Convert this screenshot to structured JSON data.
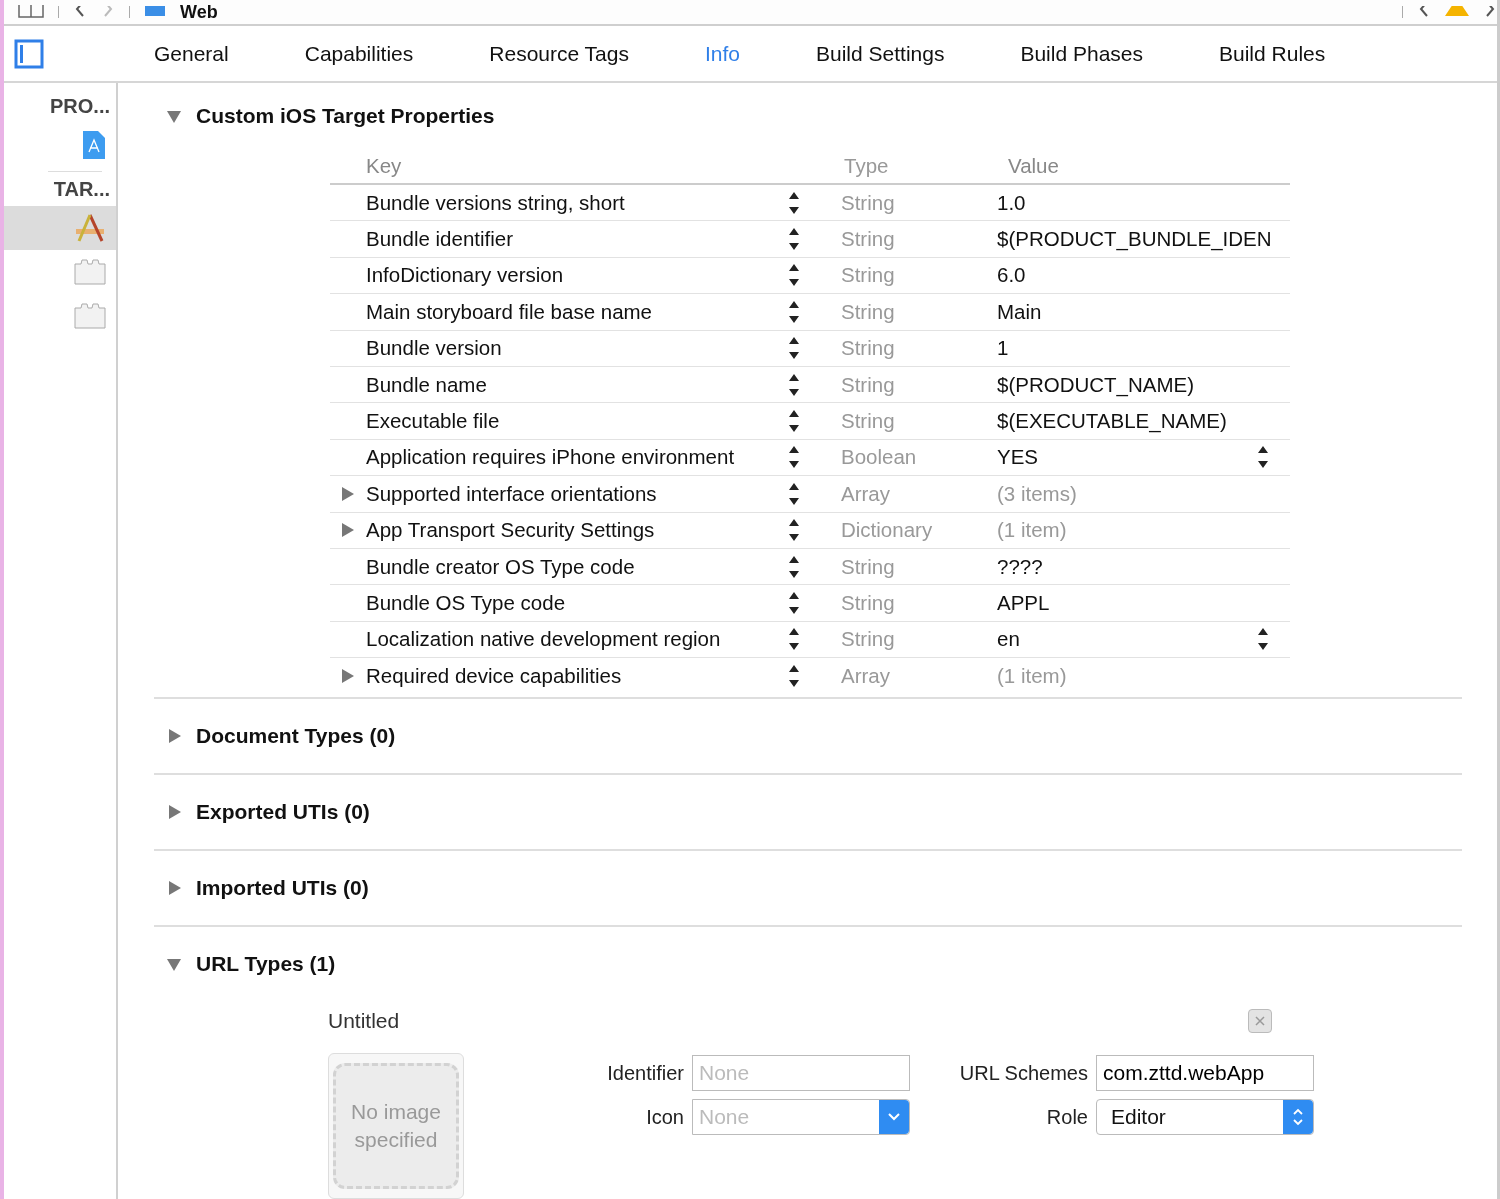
{
  "toolbar": {
    "title": "Web"
  },
  "tabs": [
    {
      "label": "General",
      "selected": false
    },
    {
      "label": "Capabilities",
      "selected": false
    },
    {
      "label": "Resource Tags",
      "selected": false
    },
    {
      "label": "Info",
      "selected": true
    },
    {
      "label": "Build Settings",
      "selected": false
    },
    {
      "label": "Build Phases",
      "selected": false
    },
    {
      "label": "Build Rules",
      "selected": false
    }
  ],
  "sidebar": {
    "groups": [
      {
        "title": "PRO...",
        "items": [
          {
            "kind": "project",
            "selected": false
          }
        ]
      },
      {
        "title": "TAR...",
        "items": [
          {
            "kind": "app",
            "selected": true
          },
          {
            "kind": "bundle",
            "selected": false
          },
          {
            "kind": "bundle",
            "selected": false
          }
        ]
      }
    ]
  },
  "sections": [
    {
      "title": "Custom iOS Target Properties",
      "expanded": true,
      "kind": "properties",
      "columns": [
        "Key",
        "Type",
        "Value"
      ],
      "rows": [
        {
          "key": "Bundle versions string, short",
          "type": "String",
          "value": "1.0",
          "expandable": false,
          "popup": false
        },
        {
          "key": "Bundle identifier",
          "type": "String",
          "value": "$(PRODUCT_BUNDLE_IDEN",
          "expandable": false,
          "popup": false
        },
        {
          "key": "InfoDictionary version",
          "type": "String",
          "value": "6.0",
          "expandable": false,
          "popup": false
        },
        {
          "key": "Main storyboard file base name",
          "type": "String",
          "value": "Main",
          "expandable": false,
          "popup": false
        },
        {
          "key": "Bundle version",
          "type": "String",
          "value": "1",
          "expandable": false,
          "popup": false
        },
        {
          "key": "Bundle name",
          "type": "String",
          "value": "$(PRODUCT_NAME)",
          "expandable": false,
          "popup": false
        },
        {
          "key": "Executable file",
          "type": "String",
          "value": "$(EXECUTABLE_NAME)",
          "expandable": false,
          "popup": false
        },
        {
          "key": "Application requires iPhone environment",
          "type": "Boolean",
          "value": "YES",
          "expandable": false,
          "popup": true
        },
        {
          "key": "Supported interface orientations",
          "type": "Array",
          "value": "(3 items)",
          "expandable": true,
          "popup": false
        },
        {
          "key": "App Transport Security Settings",
          "type": "Dictionary",
          "value": "(1 item)",
          "expandable": true,
          "popup": false
        },
        {
          "key": "Bundle creator OS Type code",
          "type": "String",
          "value": "????",
          "expandable": false,
          "popup": false
        },
        {
          "key": "Bundle OS Type code",
          "type": "String",
          "value": "APPL",
          "expandable": false,
          "popup": false
        },
        {
          "key": "Localization native development region",
          "type": "String",
          "value": "en",
          "expandable": false,
          "popup": true
        },
        {
          "key": "Required device capabilities",
          "type": "Array",
          "value": "(1 item)",
          "expandable": true,
          "popup": false
        }
      ]
    },
    {
      "title": "Document Types (0)",
      "expanded": false
    },
    {
      "title": "Exported UTIs (0)",
      "expanded": false
    },
    {
      "title": "Imported UTIs (0)",
      "expanded": false
    },
    {
      "title": "URL Types (1)",
      "expanded": true,
      "kind": "url_types",
      "url_type": {
        "name": "Untitled",
        "image_text": "No image specified",
        "identifier": {
          "label": "Identifier",
          "placeholder": "None"
        },
        "icon": {
          "label": "Icon",
          "placeholder": "None"
        },
        "schemes": {
          "label": "URL Schemes",
          "value": "com.zttd.webApp"
        },
        "role": {
          "label": "Role",
          "value": "Editor"
        }
      }
    }
  ]
}
